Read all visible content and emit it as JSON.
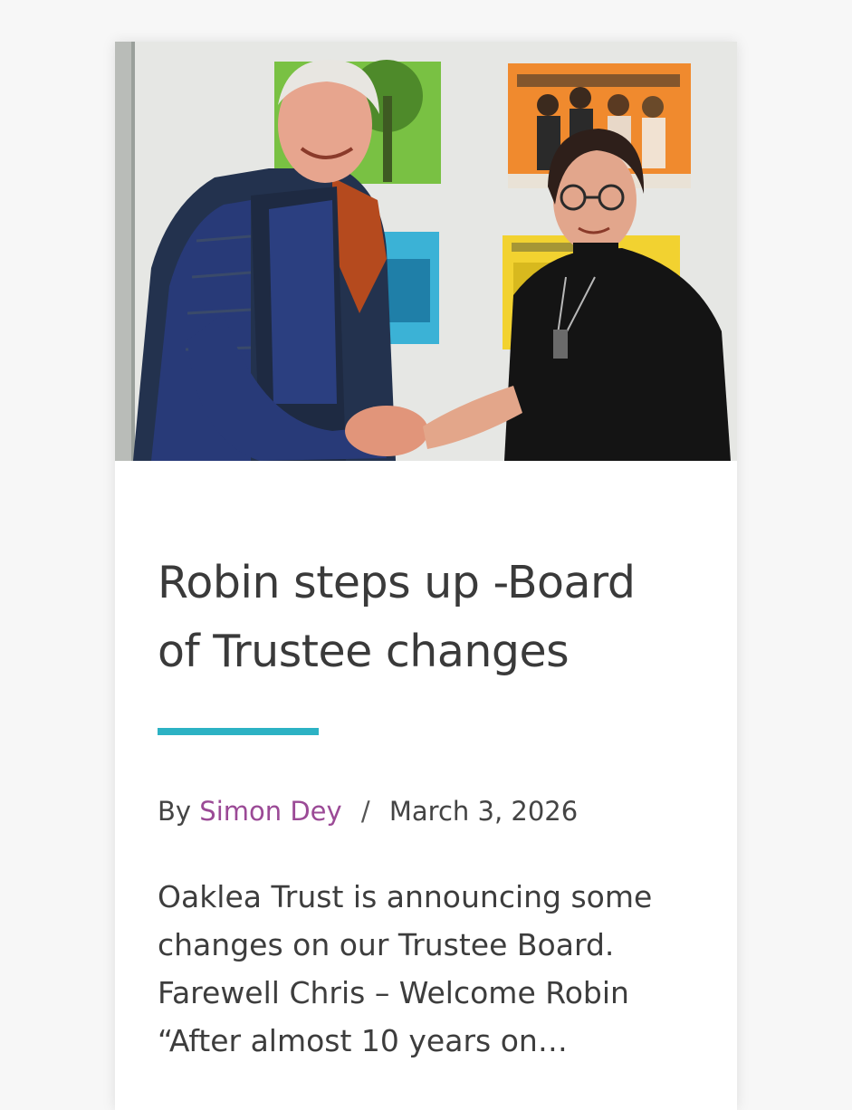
{
  "post": {
    "image_alt": "Two people shaking hands in front of posters on a wall",
    "title_line1": "Robin steps up -Board",
    "title_line2": "of Trustee changes",
    "by_label": "By",
    "author": "Simon Dey",
    "separator": "/",
    "date": "March 3, 2026",
    "excerpt_lines": [
      "Oaklea Trust is announcing some",
      "changes on our Trustee Board.",
      "Farewell Chris – Welcome Robin",
      "“After almost 10 years on…"
    ]
  },
  "colors": {
    "accent": "#2cb2c4",
    "author_link": "#9b4a96",
    "title": "#3a3a3a",
    "background": "#f7f7f7",
    "card": "#ffffff"
  }
}
